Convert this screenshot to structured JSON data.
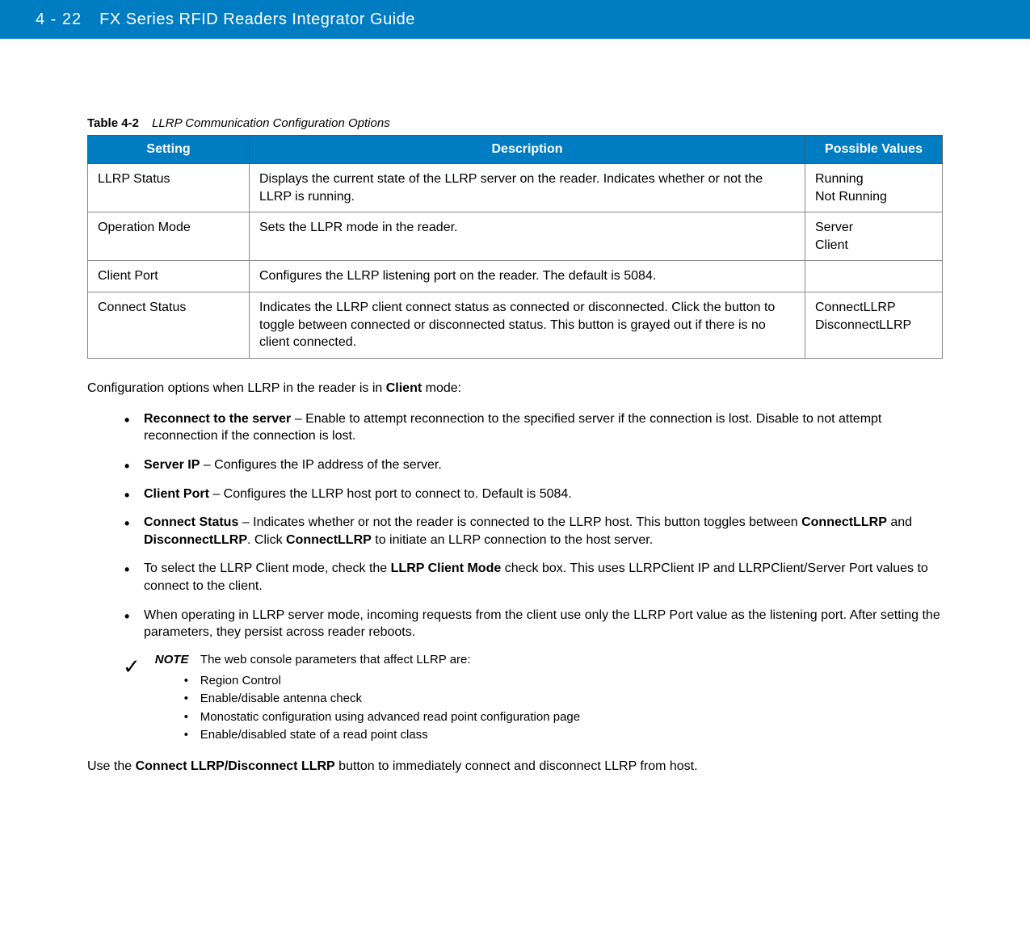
{
  "header": {
    "page_num": "4 - 22",
    "title": "FX Series RFID Readers Integrator Guide"
  },
  "table_caption": {
    "number": "Table 4-2",
    "title": "LLRP Communication Configuration Options"
  },
  "table": {
    "headers": {
      "setting": "Setting",
      "description": "Description",
      "values": "Possible Values"
    },
    "rows": [
      {
        "setting": "LLRP Status",
        "description": "Displays the current state of the LLRP server on the reader. Indicates whether or not the LLRP is running.",
        "values": [
          "Running",
          "Not Running"
        ]
      },
      {
        "setting": "Operation Mode",
        "description": "Sets the LLPR mode in the reader.",
        "values": [
          "Server",
          "Client"
        ]
      },
      {
        "setting": "Client Port",
        "description": "Configures the LLRP listening port on the reader. The default is 5084.",
        "values": []
      },
      {
        "setting": "Connect Status",
        "description": "Indicates the LLRP client connect status as connected or disconnected. Click the button to toggle between connected or disconnected status. This button is grayed out if there is no client connected.",
        "values": [
          "ConnectLLRP",
          "DisconnectLLRP"
        ]
      }
    ]
  },
  "intro": {
    "prefix": "Configuration options when LLRP in the reader is in ",
    "bold": "Client",
    "suffix": " mode:"
  },
  "bullets": [
    {
      "lead_bold": "Reconnect to the server",
      "rest": " – Enable to attempt reconnection to the specified server if the connection is lost. Disable to not attempt reconnection if the connection is lost."
    },
    {
      "lead_bold": "Server IP",
      "rest": " – Configures the IP address of the server."
    },
    {
      "lead_bold": "Client Port",
      "rest": " – Configures the LLRP host port to connect to. Default is 5084."
    },
    {
      "lead_bold": "Connect Status",
      "rest_parts": [
        " – Indicates whether or not the reader is connected to the LLRP host. This button toggles between ",
        "ConnectLLRP",
        " and ",
        "DisconnectLLRP",
        ". Click ",
        "ConnectLLRP",
        " to initiate an LLRP connection to the host server."
      ]
    },
    {
      "plain_parts": [
        "To select the LLRP Client mode, check the ",
        "LLRP Client Mode",
        " check box. This uses LLRPClient IP and LLRPClient/Server Port values to connect to the client."
      ]
    },
    {
      "plain": "When operating in LLRP server mode, incoming requests from the client use only the LLRP Port value as the listening port. After setting the parameters, they persist across reader reboots."
    }
  ],
  "note": {
    "label": "NOTE",
    "lead": "The web console parameters that affect LLRP are:",
    "items": [
      "Region Control",
      "Enable/disable antenna check",
      "Monostatic configuration using advanced read point configuration page",
      "Enable/disabled state of a read point class"
    ]
  },
  "closing": {
    "prefix": "Use the ",
    "bold": "Connect LLRP/Disconnect LLRP",
    "suffix": " button to immediately connect and disconnect LLRP from host."
  }
}
